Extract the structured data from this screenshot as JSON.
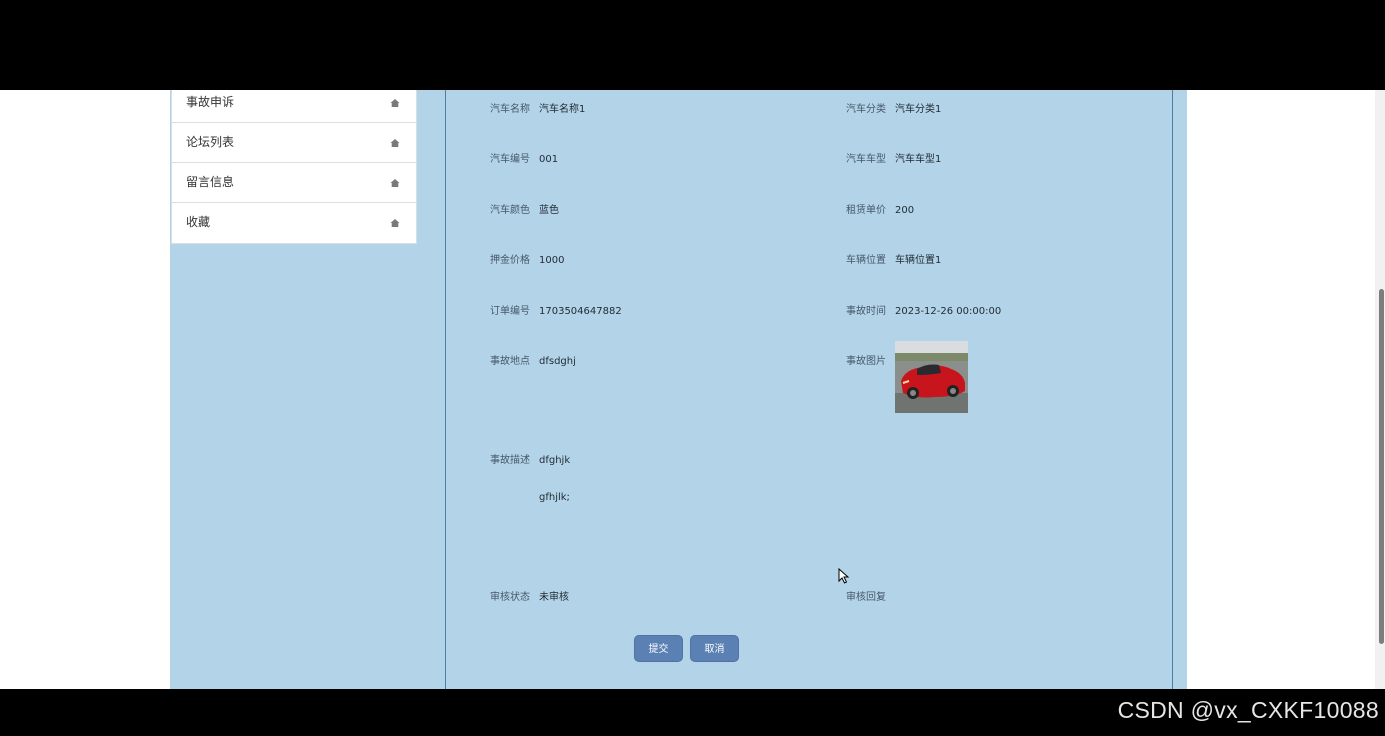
{
  "sidebar": {
    "items": [
      {
        "label": "事故申诉"
      },
      {
        "label": "论坛列表"
      },
      {
        "label": "留言信息"
      },
      {
        "label": "收藏"
      }
    ]
  },
  "form": {
    "car_name": {
      "label": "汽车名称",
      "value": "汽车名称1"
    },
    "car_category": {
      "label": "汽车分类",
      "value": "汽车分类1"
    },
    "car_number": {
      "label": "汽车编号",
      "value": "001"
    },
    "car_model": {
      "label": "汽车车型",
      "value": "汽车车型1"
    },
    "car_color": {
      "label": "汽车颜色",
      "value": "蓝色"
    },
    "rent_price": {
      "label": "租赁单价",
      "value": "200"
    },
    "deposit": {
      "label": "押金价格",
      "value": "1000"
    },
    "location": {
      "label": "车辆位置",
      "value": "车辆位置1"
    },
    "order_no": {
      "label": "订单编号",
      "value": "1703504647882"
    },
    "accident_time": {
      "label": "事故时间",
      "value": "2023-12-26 00:00:00"
    },
    "accident_place": {
      "label": "事故地点",
      "value": "dfsdghj"
    },
    "accident_image": {
      "label": "事故图片"
    },
    "accident_desc": {
      "label": "事故描述",
      "line1": "dfghjk",
      "line2": "gfhjlk;"
    },
    "review_status": {
      "label": "审核状态",
      "value": "未审核"
    },
    "review_reply": {
      "label": "审核回复",
      "value": ""
    }
  },
  "buttons": {
    "submit": "提交",
    "cancel": "取消"
  },
  "watermark": "CSDN @vx_CXKF10088",
  "colors": {
    "page_bg": "#b3d4e8",
    "button": "#5b80b3",
    "panel_border": "#4d7ea8"
  },
  "icons": {
    "sidebar": "home-icon",
    "image": "red-sports-car-photo"
  }
}
